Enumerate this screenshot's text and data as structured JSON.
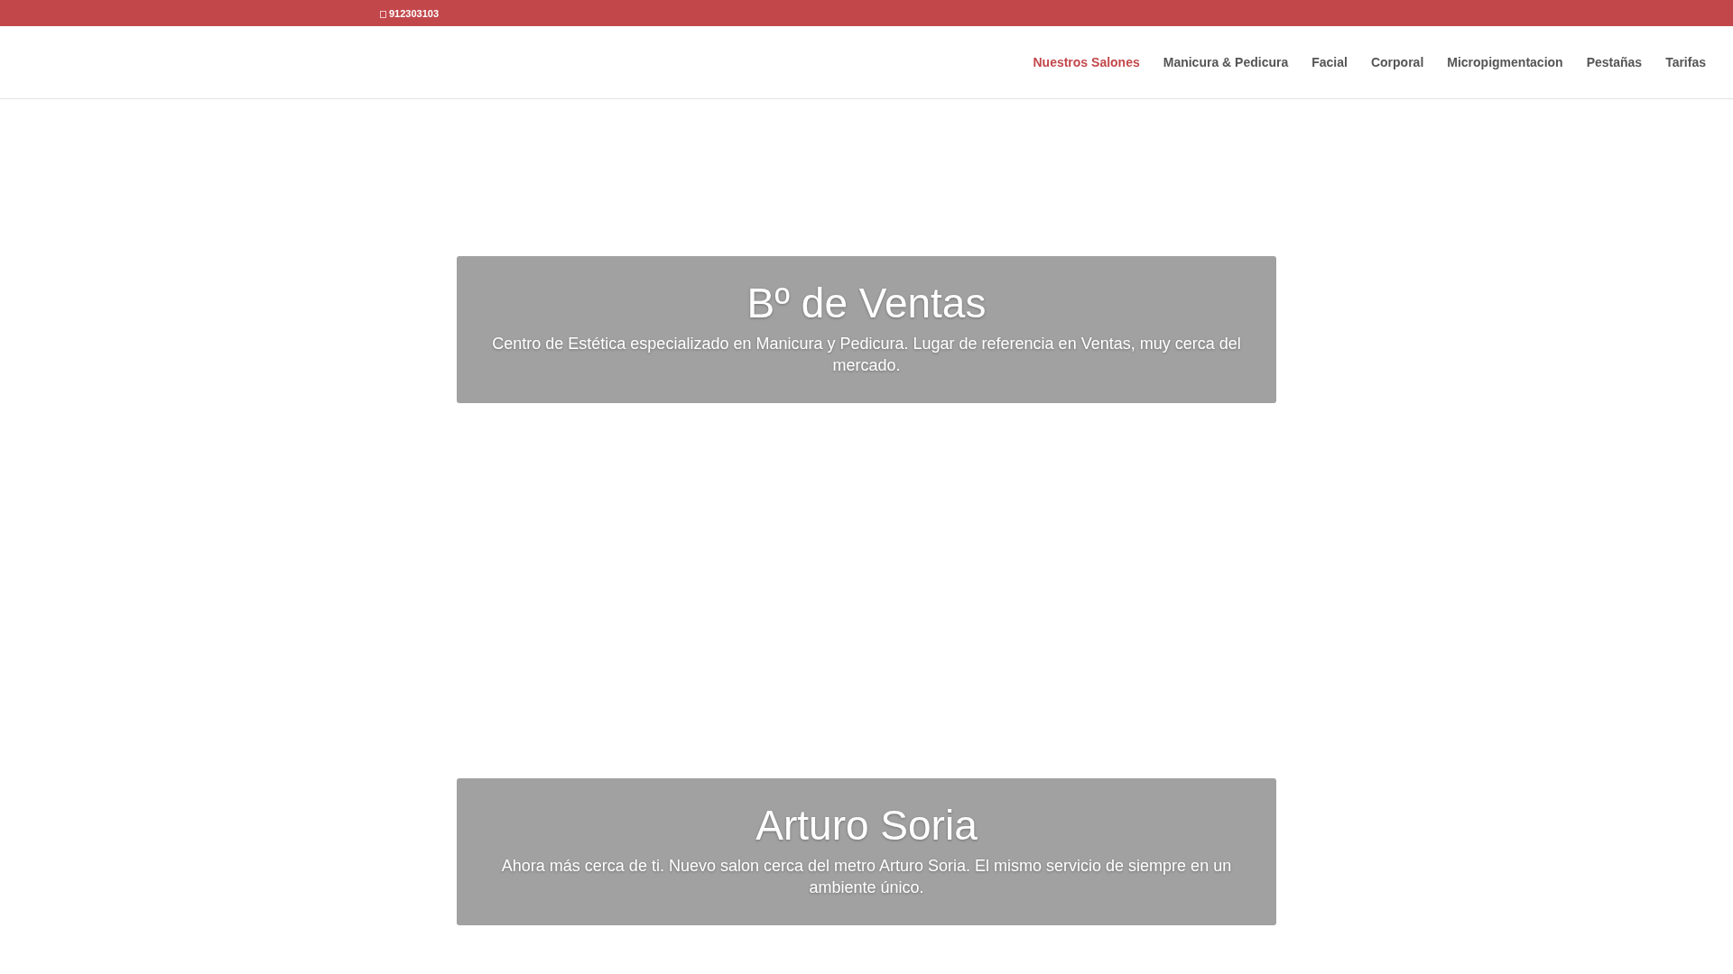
{
  "top_bar": {
    "phone": "912303103"
  },
  "nav": {
    "items": [
      {
        "label": "Nuestros Salones",
        "selected": true
      },
      {
        "label": "Manicura & Pedicura",
        "selected": false
      },
      {
        "label": "Facial",
        "selected": false
      },
      {
        "label": "Corporal",
        "selected": false
      },
      {
        "label": "Micropigmentacion",
        "selected": false
      },
      {
        "label": "Pestañas",
        "selected": false
      },
      {
        "label": "Tarifas",
        "selected": false
      }
    ]
  },
  "slides": [
    {
      "title": "Bº de Ventas",
      "description": "Centro de Estética especializado en Manicura y Pedicura. Lugar de referencia en Ventas, muy cerca del mercado."
    },
    {
      "title": "Arturo Soria",
      "description": "Ahora más cerca de ti. Nuevo salon cerca del metro Arturo Soria. El mismo servicio de siempre en un ambiente único."
    }
  ]
}
